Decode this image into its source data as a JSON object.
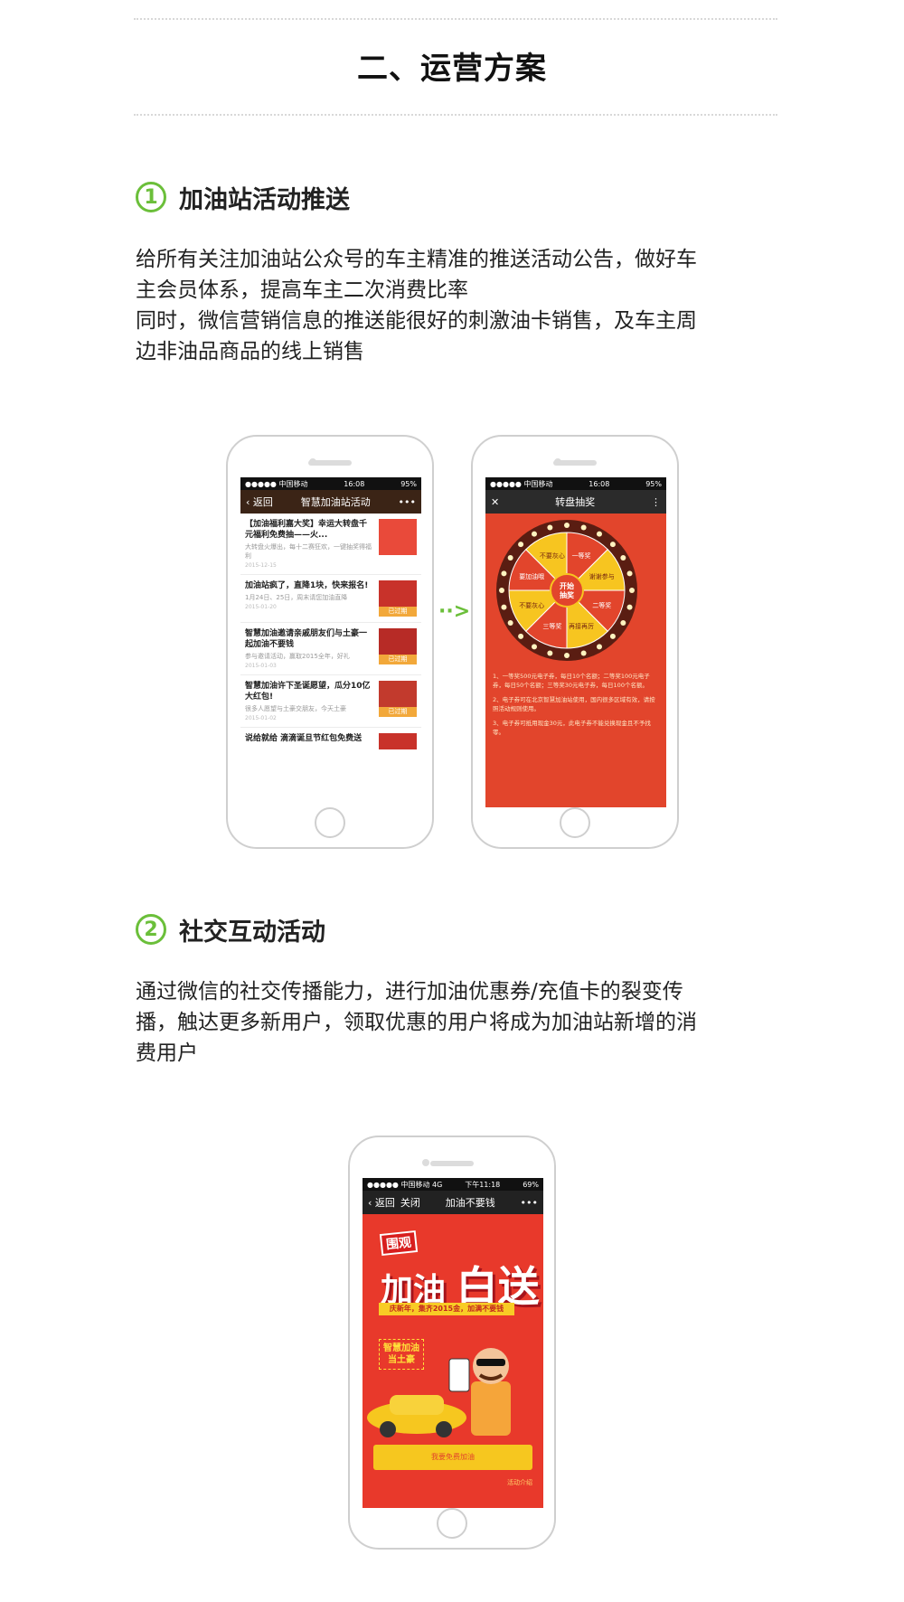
{
  "header": {
    "title": "二、运营方案"
  },
  "section1": {
    "number": "1",
    "title": "加油站活动推送",
    "lines": [
      "给所有关注加油站公众号的车主精准的推送活动公告，做好车",
      "主会员体系，提高车主二次消费比率",
      "同时，微信营销信息的推送能很好的刺激油卡销售，及车主周",
      "边非油品商品的线上销售"
    ]
  },
  "phone1": {
    "status": {
      "carrier": "●●●●● 中国移动",
      "time": "16:08",
      "battery": "95%"
    },
    "nav": {
      "back": "返回",
      "title": "智慧加油站活动",
      "more": "•••"
    },
    "items": [
      {
        "title": "【加油福利嘉大奖】幸运大转盘千元福利免费抽——火...",
        "desc": "大转盘火爆出，每十二赛狂欢，一键抽奖得福利",
        "date": "2015-12-15",
        "tag": ""
      },
      {
        "title": "加油站疯了，直降1块，快来报名!",
        "desc": "1月24日、25日，周末请您加油直降",
        "date": "2015-01-20",
        "tag": "已过期"
      },
      {
        "title": "智慧加油邀请亲戚朋友们与土豪一起加油不要钱",
        "desc": "参与邀请活动，赢取2015全年，好礼",
        "date": "2015-01-03",
        "tag": "已过期"
      },
      {
        "title": "智慧加油许下圣诞愿望，瓜分10亿大红包!",
        "desc": "很多人愿望与土豪交朋友，今天土豪",
        "date": "2015-01-02",
        "tag": "已过期"
      },
      {
        "title": "说给就给 滴滴诞旦节红包免费送",
        "desc": "",
        "date": "",
        "tag": ""
      }
    ]
  },
  "arrow": "··>",
  "phone2": {
    "status": {
      "carrier": "●●●●● 中国移动",
      "time": "16:08",
      "battery": "95%"
    },
    "nav": {
      "close": "✕",
      "title": "转盘抽奖",
      "more": "⋮"
    },
    "wheel_center": [
      "开始",
      "抽奖"
    ],
    "segments": [
      "一等奖",
      "谢谢参与",
      "二等奖",
      "再接再厉",
      "三等奖",
      "不要灰心",
      "要加油哦",
      "不要灰心"
    ],
    "rules": [
      "1、一等奖500元电子券，每日10个名额；二等奖100元电子券，每日50个名额；三等奖30元电子券，每日100个名额。",
      "2、电子券可在北京智慧加油站使用，国内很多区域有效，请按照活动规则使用。",
      "3、电子券可抵用现金30元，此电子券不能兑换现金且不予找零。"
    ]
  },
  "section2": {
    "number": "2",
    "title": "社交互动活动",
    "lines": [
      "通过微信的社交传播能力，进行加油优惠券/充值卡的裂变传",
      "播，触达更多新用户，领取优惠的用户将成为加油站新增的消",
      "费用户"
    ]
  },
  "phone3": {
    "status": {
      "carrier": "●●●●● 中国移动 4G",
      "time": "下午11:18",
      "battery": "69%"
    },
    "nav": {
      "back": "返回",
      "close": "关闭",
      "title": "加油不要钱",
      "more": "•••"
    },
    "headline_small": "围观",
    "headline_a": "加油",
    "headline_b": "白送",
    "banner": "庆新年，集齐2015金，加满不要钱",
    "badge": [
      "智慧加油",
      "当土豪"
    ],
    "button": "我要免费加油",
    "rules_link": "活动介绍"
  },
  "colors": {
    "accent_green": "#6bbf3a",
    "wheel_red": "#e2452c",
    "wheel_yellow": "#f7c520",
    "promo_red": "#e8392b"
  }
}
